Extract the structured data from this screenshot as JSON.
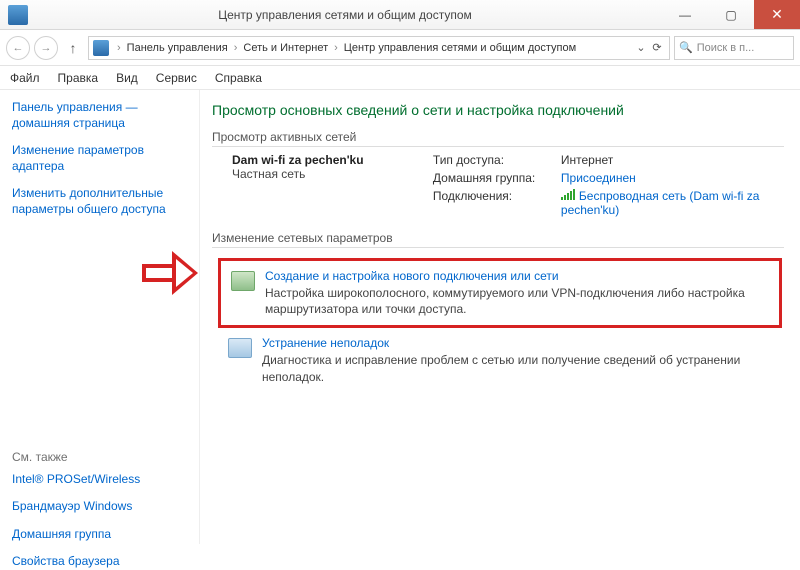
{
  "window": {
    "title": "Центр управления сетями и общим доступом"
  },
  "breadcrumbs": {
    "item1": "Панель управления",
    "item2": "Сеть и Интернет",
    "item3": "Центр управления сетями и общим доступом"
  },
  "search": {
    "placeholder": "Поиск в п..."
  },
  "menu": {
    "file": "Файл",
    "edit": "Правка",
    "view": "Вид",
    "service": "Сервис",
    "help": "Справка"
  },
  "sidebar": {
    "link1": "Панель управления — домашняя страница",
    "link2": "Изменение параметров адаптера",
    "link3": "Изменить дополнительные параметры общего доступа",
    "see_also": "См. также",
    "see1": "Intel® PROSet/Wireless",
    "see2": "Брандмауэр Windows",
    "see3": "Домашняя группа",
    "see4": "Свойства браузера"
  },
  "main": {
    "heading": "Просмотр основных сведений о сети и настройка подключений",
    "active_label": "Просмотр активных сетей",
    "net_name": "Dam wi-fi za pechen'ku",
    "net_type": "Частная сеть",
    "access_lbl": "Тип доступа:",
    "access_val": "Интернет",
    "homegroup_lbl": "Домашняя группа:",
    "homegroup_val": "Присоединен",
    "conn_lbl": "Подключения:",
    "conn_val": "Беспроводная сеть (Dam wi-fi za pechen'ku)",
    "change_label": "Изменение сетевых параметров",
    "opt1_title": "Создание и настройка нового подключения или сети",
    "opt1_desc": "Настройка широкополосного, коммутируемого или VPN-подключения либо настройка маршрутизатора или точки доступа.",
    "opt2_title": "Устранение неполадок",
    "opt2_desc": "Диагностика и исправление проблем с сетью или получение сведений об устранении неполадок."
  }
}
